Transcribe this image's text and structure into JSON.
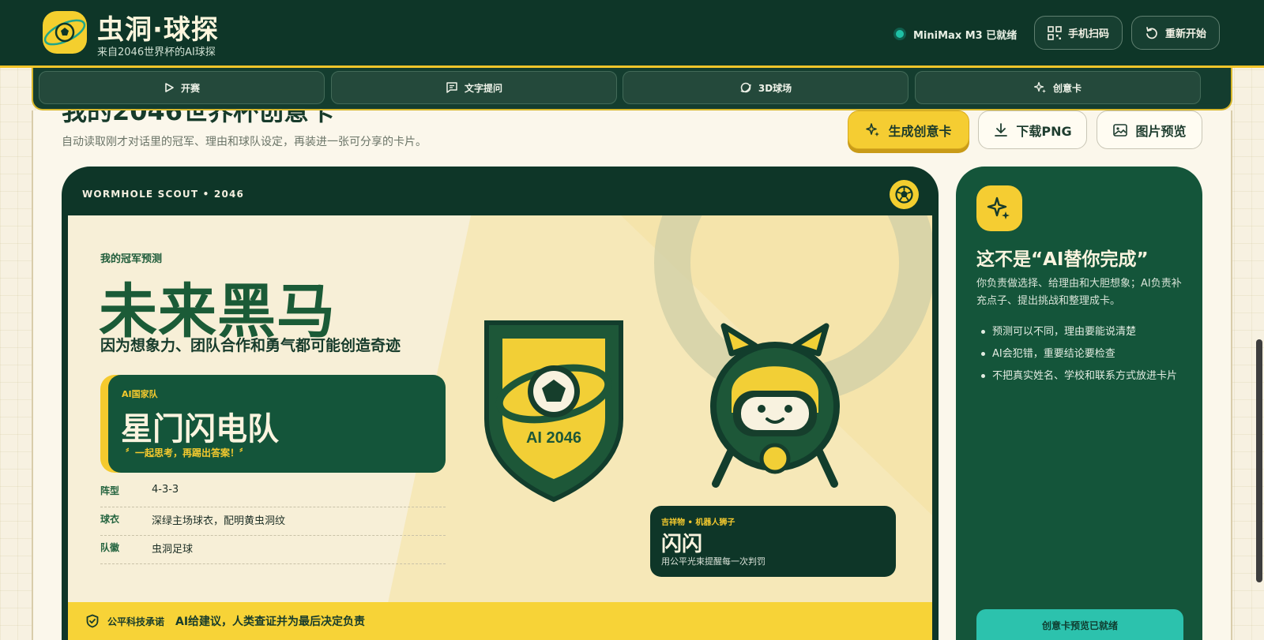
{
  "header": {
    "brand_title": "虫洞·球探",
    "brand_sub": "来自2046世界杯的AI球探",
    "status_text": "MiniMax M3 已就绪",
    "scan_label": "手机扫码",
    "restart_label": "重新开始"
  },
  "nav": {
    "tabs": [
      {
        "label": "开赛",
        "icon": "play-icon"
      },
      {
        "label": "文字提问",
        "icon": "chat-icon"
      },
      {
        "label": "3D球场",
        "icon": "orbit-icon"
      },
      {
        "label": "创意卡",
        "icon": "sparkle-icon"
      }
    ]
  },
  "page": {
    "title": "我的2046世界杯创意卡",
    "subtitle": "自动读取刚才对话里的冠军、理由和球队设定，再装进一张可分享的卡片。",
    "actions": {
      "generate": "生成创意卡",
      "download": "下载PNG",
      "preview": "图片预览"
    }
  },
  "card": {
    "top_label": "WORMHOLE SCOUT • 2046",
    "pick_label": "我的冠军预测",
    "pick_name": "未来黑马",
    "pick_reason": "因为想象力、团队合作和勇气都可能创造奇迹",
    "team_tag": "AI国家队",
    "team_name": "星门闪电队",
    "team_slogan": "〞一起思考，再踢出答案！〞",
    "rows": [
      {
        "key": "阵型",
        "value": "4-3-3"
      },
      {
        "key": "球衣",
        "value": "深绿主场球衣，配明黄虫洞纹"
      },
      {
        "key": "队徽",
        "value": "虫洞足球"
      }
    ],
    "badge_text": "AI 2046",
    "mascot_tag": "吉祥物 • 机器人狮子",
    "mascot_name": "闪闪",
    "mascot_desc": "用公平光束提醒每一次判罚",
    "promise_label": "公平科技承诺",
    "promise_text": "AI给建议，人类查证并为最后决定负责"
  },
  "side": {
    "title": "这不是“AI替你完成”",
    "desc": "你负责做选择、给理由和大胆想象；AI负责补充点子、提出挑战和整理成卡。",
    "items": [
      "预测可以不同，理由要能说清楚",
      "AI会犯错，重要结论要检查",
      "不把真实姓名、学校和联系方式放进卡片"
    ],
    "status": "创意卡预览已就绪"
  },
  "colors": {
    "primary_green": "#0e3628",
    "brand_green": "#14553a",
    "accent_yellow": "#f5cd32",
    "cream": "#f7efd7",
    "teal": "#2cc2ad"
  }
}
